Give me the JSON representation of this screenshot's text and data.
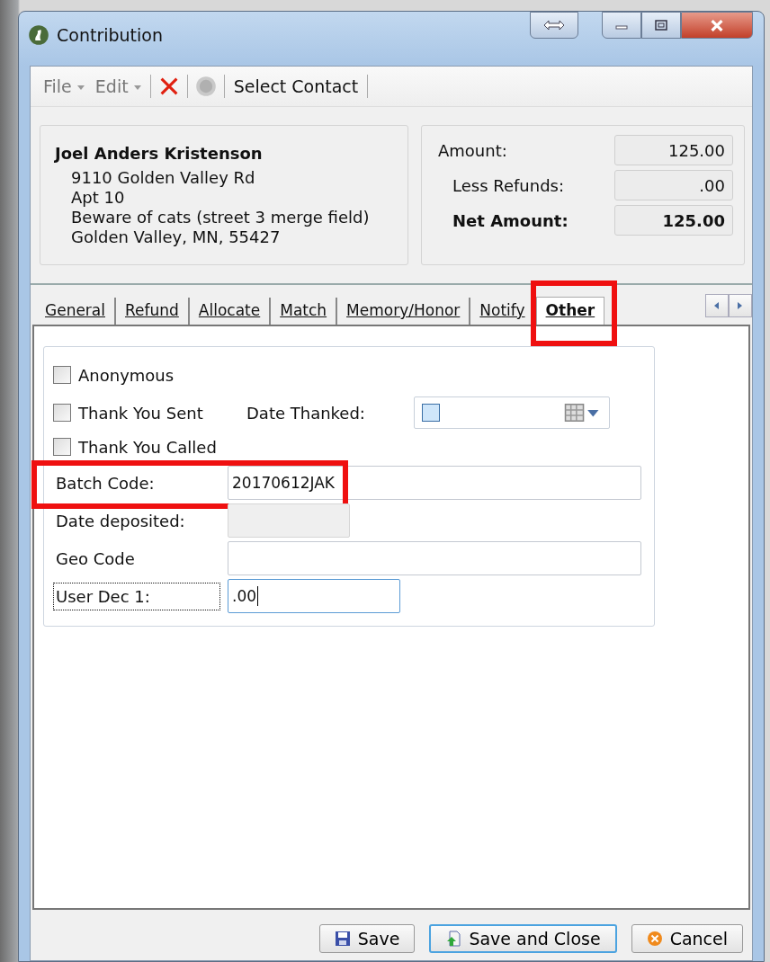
{
  "window": {
    "title": "Contribution"
  },
  "toolbar": {
    "menus": [
      {
        "label": "File"
      },
      {
        "label": "Edit"
      }
    ],
    "action": "Select Contact"
  },
  "contact": {
    "name": "Joel Anders Kristenson",
    "lines": [
      "9110 Golden Valley Rd",
      "Apt 10",
      "Beware of cats (street 3 merge field)",
      "Golden Valley, MN, 55427"
    ]
  },
  "amounts": [
    {
      "label": "Amount:",
      "value": "125.00",
      "bold": false
    },
    {
      "label": "Less Refunds:",
      "value": ".00",
      "bold": false
    },
    {
      "label": "Net Amount:",
      "value": "125.00",
      "bold": true
    }
  ],
  "tabs": [
    {
      "label": "General",
      "selected": false,
      "highlighted": false
    },
    {
      "label": "Refund",
      "selected": false,
      "highlighted": false
    },
    {
      "label": "Allocate",
      "selected": false,
      "highlighted": false
    },
    {
      "label": "Match",
      "selected": false,
      "highlighted": false
    },
    {
      "label": "Memory/Honor",
      "selected": false,
      "highlighted": false
    },
    {
      "label": "Notify",
      "selected": false,
      "highlighted": false
    },
    {
      "label": "Other",
      "selected": true,
      "highlighted": true
    }
  ],
  "rows": [
    {
      "kind": "checkbox",
      "label": "Anonymous",
      "checked": false
    },
    {
      "kind": "checkbox_date",
      "label": "Thank You Sent",
      "checked": false,
      "date_label": "Date Thanked:",
      "date_checked": false
    },
    {
      "kind": "checkbox",
      "label": "Thank You Called",
      "checked": false
    },
    {
      "kind": "field",
      "label": "Batch Code:",
      "value": "20170612JAK",
      "highlighted": true,
      "disabled": false,
      "focused": false
    },
    {
      "kind": "field",
      "label": "Date deposited:",
      "highlighted": false,
      "disabled": true,
      "focused": false
    },
    {
      "kind": "field",
      "label": "Geo Code",
      "highlighted": false,
      "disabled": false,
      "focused": false
    },
    {
      "kind": "field",
      "label": "User Dec 1:",
      "value": ".00",
      "highlighted": false,
      "disabled": false,
      "focused": true
    }
  ],
  "buttons": [
    {
      "kind": "save",
      "label": "Save",
      "default": false
    },
    {
      "kind": "save_close",
      "label": "Save and Close",
      "default": true
    },
    {
      "kind": "cancel",
      "label": "Cancel",
      "default": false
    }
  ]
}
